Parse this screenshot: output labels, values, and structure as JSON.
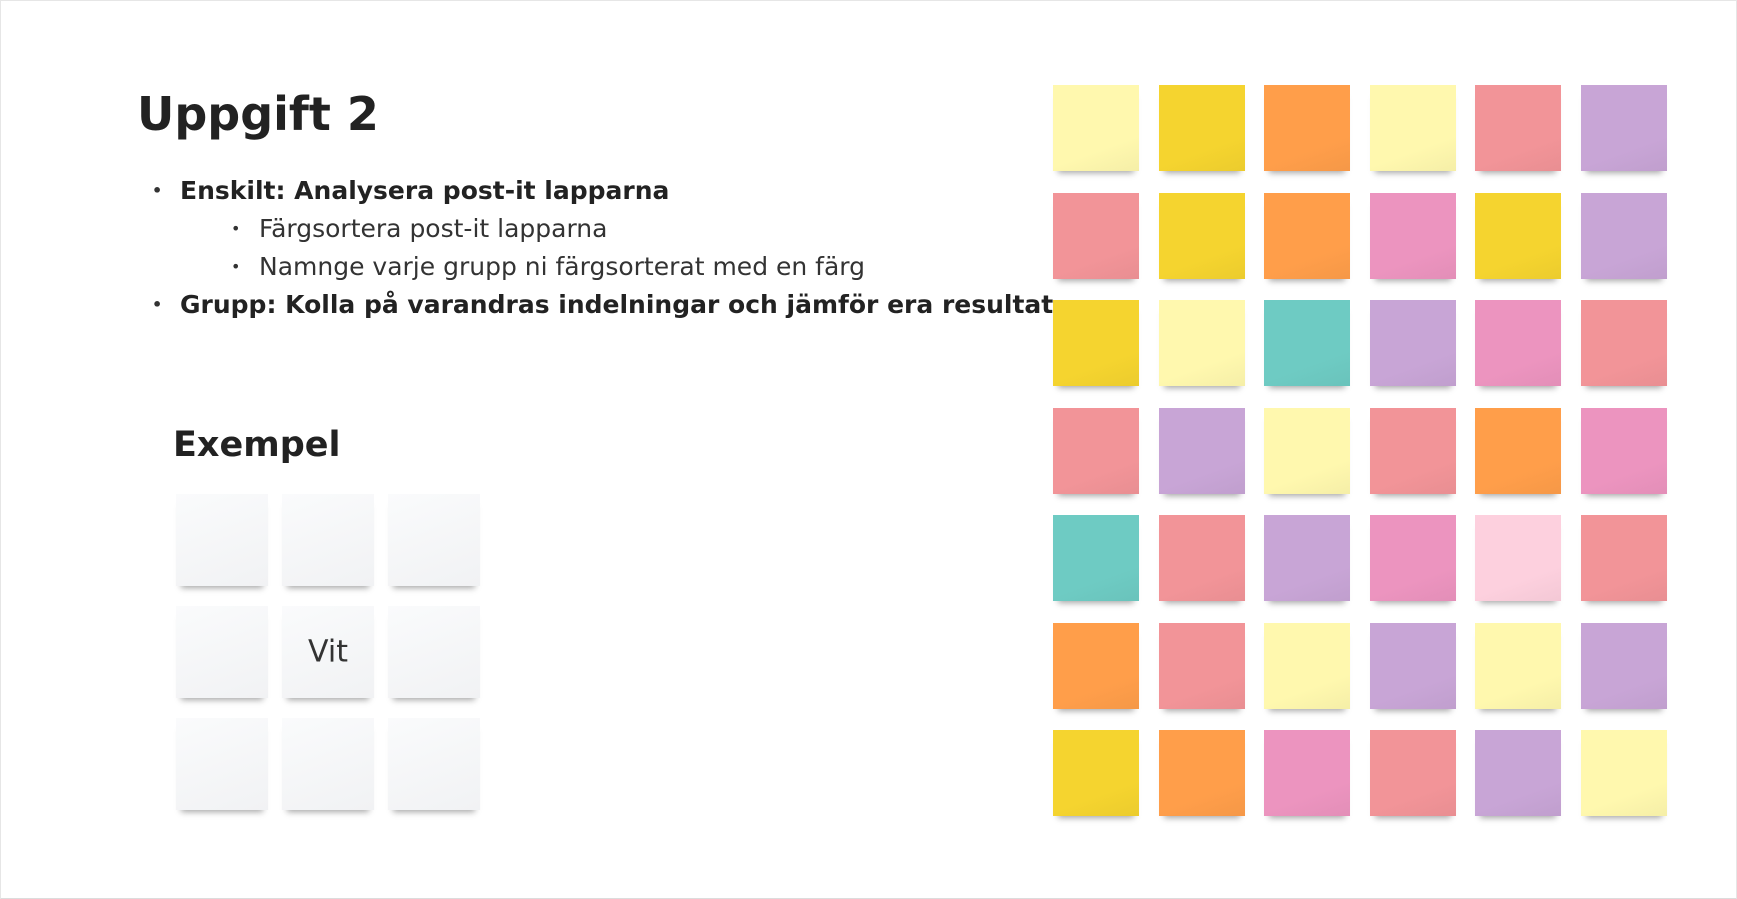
{
  "slide": {
    "title": "Uppgift 2",
    "bullets": [
      {
        "text": "Enskilt: Analysera post-it lapparna",
        "level": 1
      },
      {
        "text": "Färgsortera post-it lapparna",
        "level": 2
      },
      {
        "text": "Namnge varje grupp ni färgsorterat med en färg",
        "level": 2
      },
      {
        "text": "Grupp: Kolla på varandras indelningar och jämför era resultat",
        "level": 1
      }
    ],
    "example": {
      "heading": "Exempel",
      "label": "Vit",
      "color": "#f3f4f6"
    }
  },
  "palette": {
    "light-yellow": "#fff8ae",
    "yellow": "#f5d42f",
    "orange": "#ff9e4a",
    "red": "#f29498",
    "purple": "#c8a5d6",
    "pink": "#ec94bf",
    "teal": "#6ecbc3",
    "light-pink": "#fdd0de"
  },
  "sticky_grid": [
    [
      "light-yellow",
      "yellow",
      "orange",
      "light-yellow",
      "red",
      "purple"
    ],
    [
      "red",
      "yellow",
      "orange",
      "pink",
      "yellow",
      "purple"
    ],
    [
      "yellow",
      "light-yellow",
      "teal",
      "purple",
      "pink",
      "red"
    ],
    [
      "red",
      "purple",
      "light-yellow",
      "red",
      "orange",
      "pink"
    ],
    [
      "teal",
      "red",
      "purple",
      "pink",
      "light-pink",
      "red"
    ],
    [
      "orange",
      "red",
      "light-yellow",
      "purple",
      "light-yellow",
      "purple"
    ],
    [
      "yellow",
      "orange",
      "pink",
      "red",
      "purple",
      "light-yellow"
    ]
  ]
}
